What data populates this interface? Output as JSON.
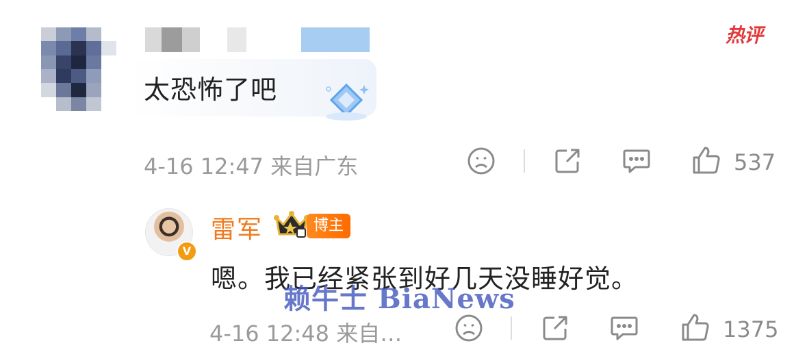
{
  "comment": {
    "text": "太恐怖了吧",
    "date": "4-16",
    "time": "12:47",
    "location": "来自广东",
    "like_count": "537",
    "hot_badge": "热评"
  },
  "reply": {
    "author": "雷军",
    "tag": "博主",
    "text": "嗯。我已经紧张到好几天没睡好觉。",
    "date": "4-16",
    "time": "12:48",
    "location": "来自…",
    "like_count": "1375",
    "verified_badge": "V"
  },
  "watermark": "赖牛士 BiaNews",
  "colors": {
    "accent_orange": "#f07a1d",
    "hot_red": "#e4393c",
    "meta_gray": "#9a9a9a",
    "watermark_blue": "#4a5cbf"
  },
  "icons": [
    "sad-face-icon",
    "share-icon",
    "comment-icon",
    "thumbs-up-icon",
    "diamond-icon",
    "crown-icon"
  ]
}
